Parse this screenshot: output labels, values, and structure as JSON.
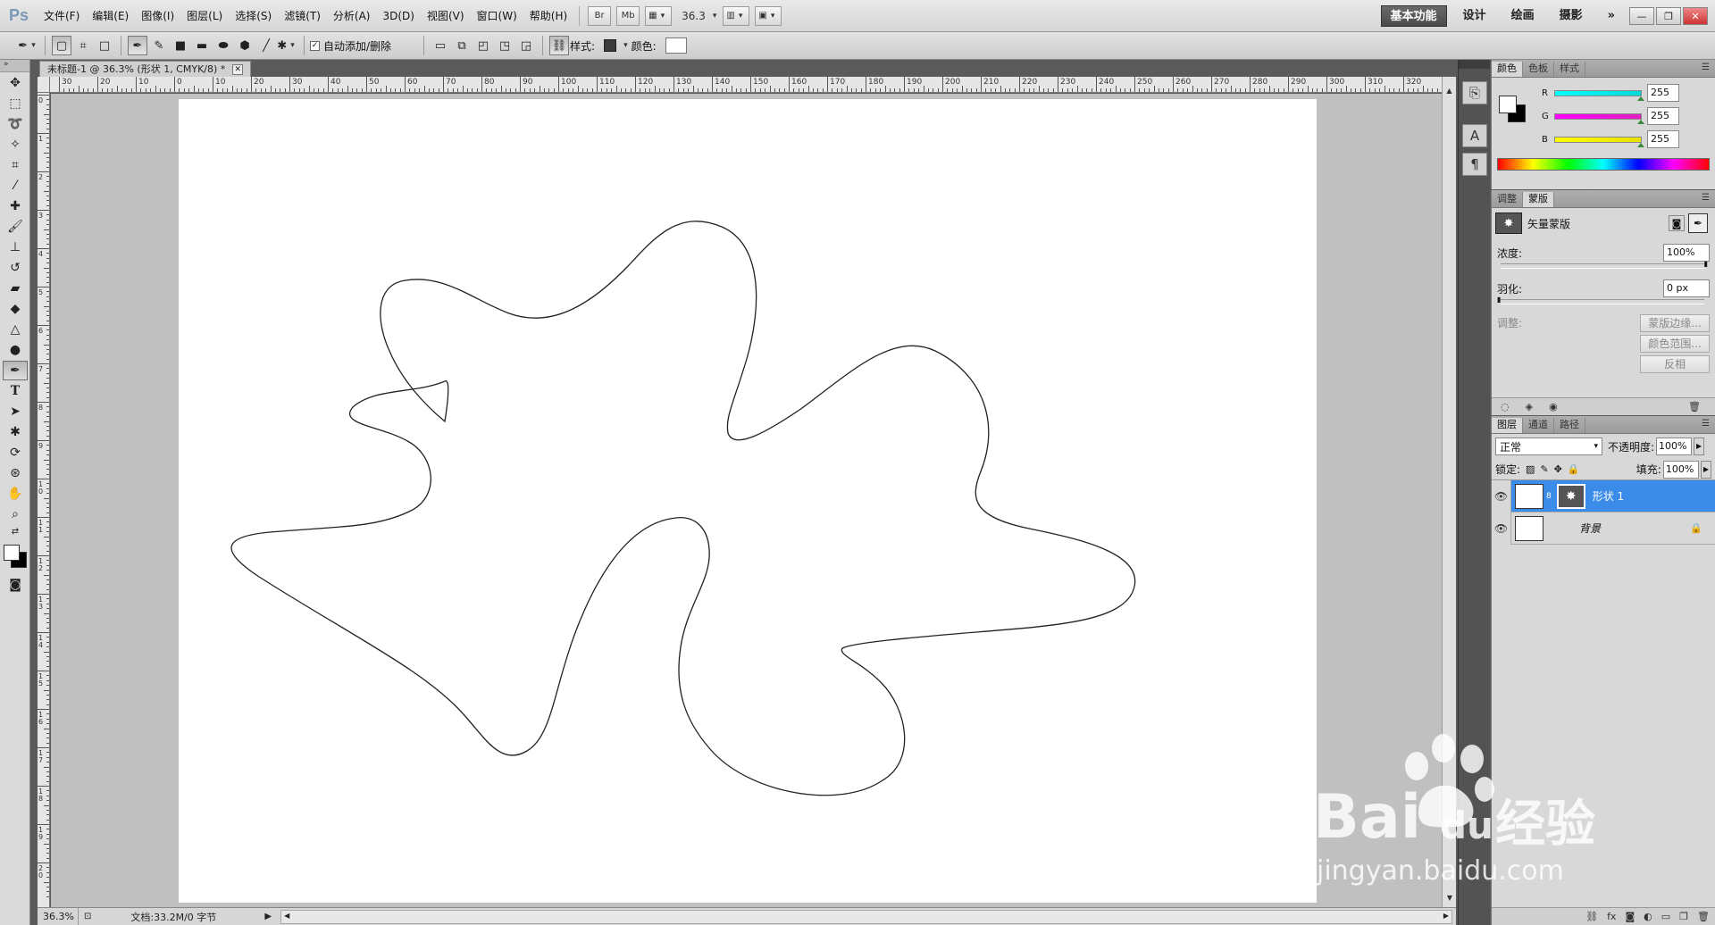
{
  "app": {
    "logo": "Ps"
  },
  "menu": [
    "文件(F)",
    "编辑(E)",
    "图像(I)",
    "图层(L)",
    "选择(S)",
    "滤镜(T)",
    "分析(A)",
    "3D(D)",
    "视图(V)",
    "窗口(W)",
    "帮助(H)"
  ],
  "menubar": {
    "br": "Br",
    "mb": "Mb",
    "zoom": "36.3"
  },
  "workspace": {
    "items": [
      "基本功能",
      "设计",
      "绘画",
      "摄影"
    ],
    "more": "»"
  },
  "options": {
    "auto_add_delete": "自动添加/删除",
    "style_label": "样式:",
    "color_label": "颜色:"
  },
  "document": {
    "tab_title": "未标题-1 @ 36.3% (形状 1, CMYK/8) *",
    "zoom_status": "36.3%",
    "doc_info": "文档:33.2M/0 字节"
  },
  "ruler": {
    "top_labels": [
      "30",
      "20",
      "10",
      "0",
      "10",
      "20",
      "30",
      "40",
      "50",
      "60",
      "70",
      "80",
      "90",
      "100",
      "110",
      "120",
      "130",
      "140",
      "150",
      "160",
      "170",
      "180",
      "190",
      "200",
      "210",
      "220",
      "230",
      "240",
      "250",
      "260",
      "270",
      "280",
      "290",
      "300",
      "310",
      "320"
    ],
    "left_labels": [
      "0",
      "1",
      "2",
      "3",
      "4",
      "5",
      "6",
      "7",
      "8",
      "9",
      "10",
      "11",
      "12",
      "13",
      "14",
      "15",
      "16",
      "17",
      "18",
      "19",
      "20"
    ]
  },
  "color_panel": {
    "tabs": [
      "颜色",
      "色板",
      "样式"
    ],
    "channels": [
      {
        "label": "R",
        "value": "255",
        "gradient": "#00d8d8"
      },
      {
        "label": "G",
        "value": "255",
        "gradient": "#e020c0"
      },
      {
        "label": "B",
        "value": "255",
        "gradient": "#e8e000"
      }
    ]
  },
  "masks_panel": {
    "tabs": [
      "调整",
      "蒙版"
    ],
    "title": "矢量蒙版",
    "density_label": "浓度:",
    "density_value": "100%",
    "feather_label": "羽化:",
    "feather_value": "0 px",
    "refine_label": "调整:",
    "buttons": [
      "蒙版边缘...",
      "颜色范围...",
      "反相"
    ]
  },
  "layers_panel": {
    "tabs": [
      "图层",
      "通道",
      "路径"
    ],
    "blend_mode": "正常",
    "opacity_label": "不透明度:",
    "opacity_value": "100%",
    "lock_label": "锁定:",
    "fill_label": "填充:",
    "fill_value": "100%",
    "layers": [
      {
        "name": "形状 1",
        "selected": true
      },
      {
        "name": "背景",
        "selected": false
      }
    ]
  },
  "watermark": {
    "brand_latin": "Bai",
    "brand_du": "du",
    "brand_cn": "经验",
    "url": "jingyan.baidu.com"
  }
}
